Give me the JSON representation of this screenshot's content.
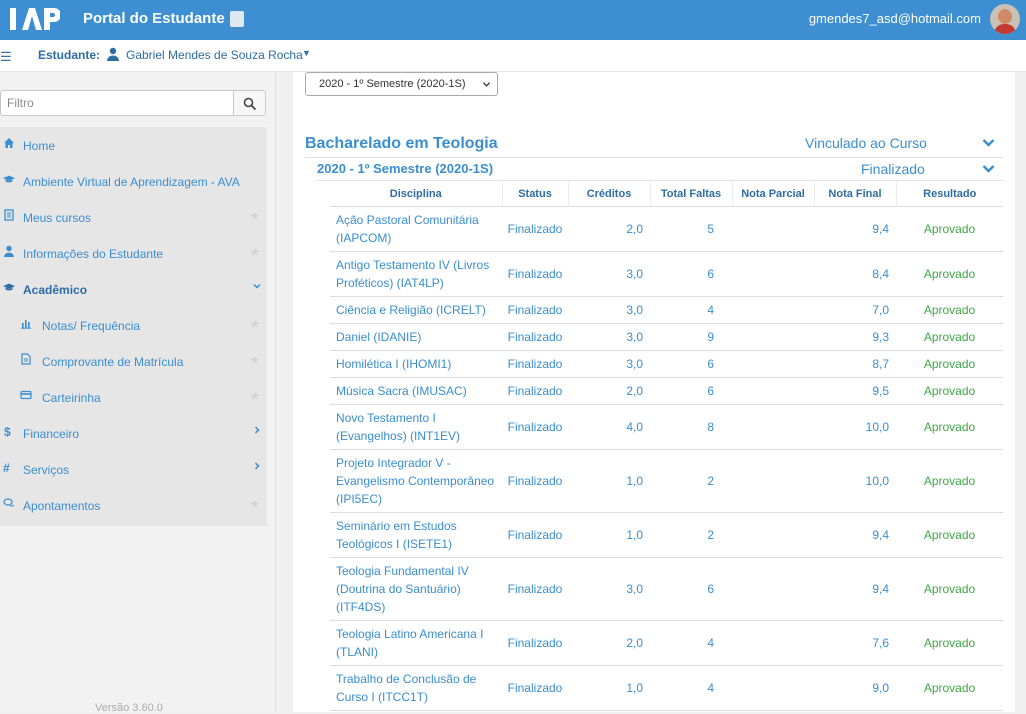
{
  "header": {
    "app_title": "Portal do Estudante",
    "user_email": "gmendes7_asd@hotmail.com",
    "brand_color": "#3d8fd1"
  },
  "student_bar": {
    "label": "Estudante:",
    "name": "Gabriel Mendes de Souza Rocha"
  },
  "sidebar": {
    "filter_placeholder": "Filtro",
    "items": [
      {
        "label": "Home",
        "icon": "home-icon"
      },
      {
        "label": "Ambiente Virtual de Aprendizagem - AVA",
        "icon": "graduation-cap-icon"
      },
      {
        "label": "Meus cursos",
        "icon": "document-icon"
      },
      {
        "label": "Informações do Estudante",
        "icon": "user-icon"
      },
      {
        "label": "Acadêmico",
        "icon": "graduation-cap-icon"
      },
      {
        "label": "Notas/ Frequência",
        "icon": "bar-chart-icon"
      },
      {
        "label": "Comprovante de Matrícula",
        "icon": "file-text-icon"
      },
      {
        "label": "Carteirinha",
        "icon": "credit-card-icon"
      },
      {
        "label": "Financeiro",
        "icon": "dollar-icon"
      },
      {
        "label": "Serviços",
        "icon": "hashtag-icon"
      },
      {
        "label": "Apontamentos",
        "icon": "comments-icon"
      }
    ],
    "version": "Versão 3.60.0"
  },
  "content": {
    "semester_select_value": "2020 - 1º Semestre (2020-1S)",
    "course_title": "Bacharelado em Teologia",
    "course_status": "Vinculado ao Curso",
    "semester_title": "2020 - 1º Semestre (2020-1S)",
    "semester_status": "Finalizado",
    "table": {
      "headers": [
        "Disciplina",
        "Status",
        "Créditos",
        "Total Faltas",
        "Nota Parcial",
        "Nota Final",
        "Resultado"
      ],
      "rows": [
        {
          "disciplina": "Ação Pastoral Comunitária (IAPCOM)",
          "status": "Finalizado",
          "creditos": "2,0",
          "faltas": "5",
          "parcial": "",
          "final": "9,4",
          "resultado": "Aprovado"
        },
        {
          "disciplina": "Antigo Testamento IV (Livros Proféticos) (IAT4LP)",
          "status": "Finalizado",
          "creditos": "3,0",
          "faltas": "6",
          "parcial": "",
          "final": "8,4",
          "resultado": "Aprovado"
        },
        {
          "disciplina": "Ciência e Religião (ICRELT)",
          "status": "Finalizado",
          "creditos": "3,0",
          "faltas": "4",
          "parcial": "",
          "final": "7,0",
          "resultado": "Aprovado"
        },
        {
          "disciplina": "Daniel (IDANIE)",
          "status": "Finalizado",
          "creditos": "3,0",
          "faltas": "9",
          "parcial": "",
          "final": "9,3",
          "resultado": "Aprovado"
        },
        {
          "disciplina": "Homilética I (IHOMI1)",
          "status": "Finalizado",
          "creditos": "3,0",
          "faltas": "6",
          "parcial": "",
          "final": "8,7",
          "resultado": "Aprovado"
        },
        {
          "disciplina": "Música Sacra (IMUSAC)",
          "status": "Finalizado",
          "creditos": "2,0",
          "faltas": "6",
          "parcial": "",
          "final": "9,5",
          "resultado": "Aprovado"
        },
        {
          "disciplina": "Novo Testamento I (Evangelhos) (INT1EV)",
          "status": "Finalizado",
          "creditos": "4,0",
          "faltas": "8",
          "parcial": "",
          "final": "10,0",
          "resultado": "Aprovado"
        },
        {
          "disciplina": "Projeto Integrador V - Evangelismo Contemporâneo (IPI5EC)",
          "status": "Finalizado",
          "creditos": "1,0",
          "faltas": "2",
          "parcial": "",
          "final": "10,0",
          "resultado": "Aprovado"
        },
        {
          "disciplina": "Seminário em Estudos Teológicos I (ISETE1)",
          "status": "Finalizado",
          "creditos": "1,0",
          "faltas": "2",
          "parcial": "",
          "final": "9,4",
          "resultado": "Aprovado"
        },
        {
          "disciplina": "Teologia Fundamental IV (Doutrina do Santuário) (ITF4DS)",
          "status": "Finalizado",
          "creditos": "3,0",
          "faltas": "6",
          "parcial": "",
          "final": "9,4",
          "resultado": "Aprovado"
        },
        {
          "disciplina": "Teologia Latino Americana I (TLANI)",
          "status": "Finalizado",
          "creditos": "2,0",
          "faltas": "4",
          "parcial": "",
          "final": "7,6",
          "resultado": "Aprovado"
        },
        {
          "disciplina": "Trabalho de Conclusão de Curso I (ITCC1T)",
          "status": "Finalizado",
          "creditos": "1,0",
          "faltas": "4",
          "parcial": "",
          "final": "9,0",
          "resultado": "Aprovado"
        }
      ]
    }
  }
}
